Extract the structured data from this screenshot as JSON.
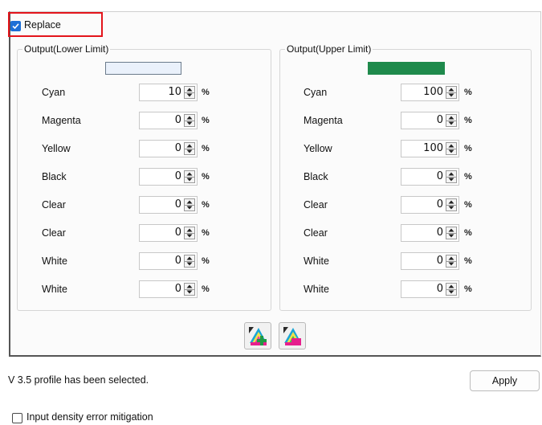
{
  "replace": {
    "label": "Replace",
    "checked": true
  },
  "lower": {
    "title": "Output(Lower Limit)",
    "swatch_color": "#eaf1fb",
    "rows": [
      {
        "label": "Cyan",
        "value": "10",
        "unit": "%"
      },
      {
        "label": "Magenta",
        "value": "0",
        "unit": "%"
      },
      {
        "label": "Yellow",
        "value": "0",
        "unit": "%"
      },
      {
        "label": "Black",
        "value": "0",
        "unit": "%"
      },
      {
        "label": "Clear",
        "value": "0",
        "unit": "%"
      },
      {
        "label": "Clear",
        "value": "0",
        "unit": "%"
      },
      {
        "label": "White",
        "value": "0",
        "unit": "%"
      },
      {
        "label": "White",
        "value": "0",
        "unit": "%"
      }
    ]
  },
  "upper": {
    "title": "Output(Upper Limit)",
    "swatch_color": "#1f8a4c",
    "rows": [
      {
        "label": "Cyan",
        "value": "100",
        "unit": "%"
      },
      {
        "label": "Magenta",
        "value": "0",
        "unit": "%"
      },
      {
        "label": "Yellow",
        "value": "100",
        "unit": "%"
      },
      {
        "label": "Black",
        "value": "0",
        "unit": "%"
      },
      {
        "label": "Clear",
        "value": "0",
        "unit": "%"
      },
      {
        "label": "Clear",
        "value": "0",
        "unit": "%"
      },
      {
        "label": "White",
        "value": "0",
        "unit": "%"
      },
      {
        "label": "White",
        "value": "0",
        "unit": "%"
      }
    ]
  },
  "toolbar": {
    "icons": [
      "color-add-icon",
      "color-remove-icon"
    ]
  },
  "status": {
    "message": "V 3.5 profile has been selected."
  },
  "apply_label": "Apply",
  "mitigation": {
    "label": "Input density error mitigation",
    "checked": false
  },
  "colors": {
    "accent": "#1d6fd6",
    "highlight": "#e3141b"
  }
}
